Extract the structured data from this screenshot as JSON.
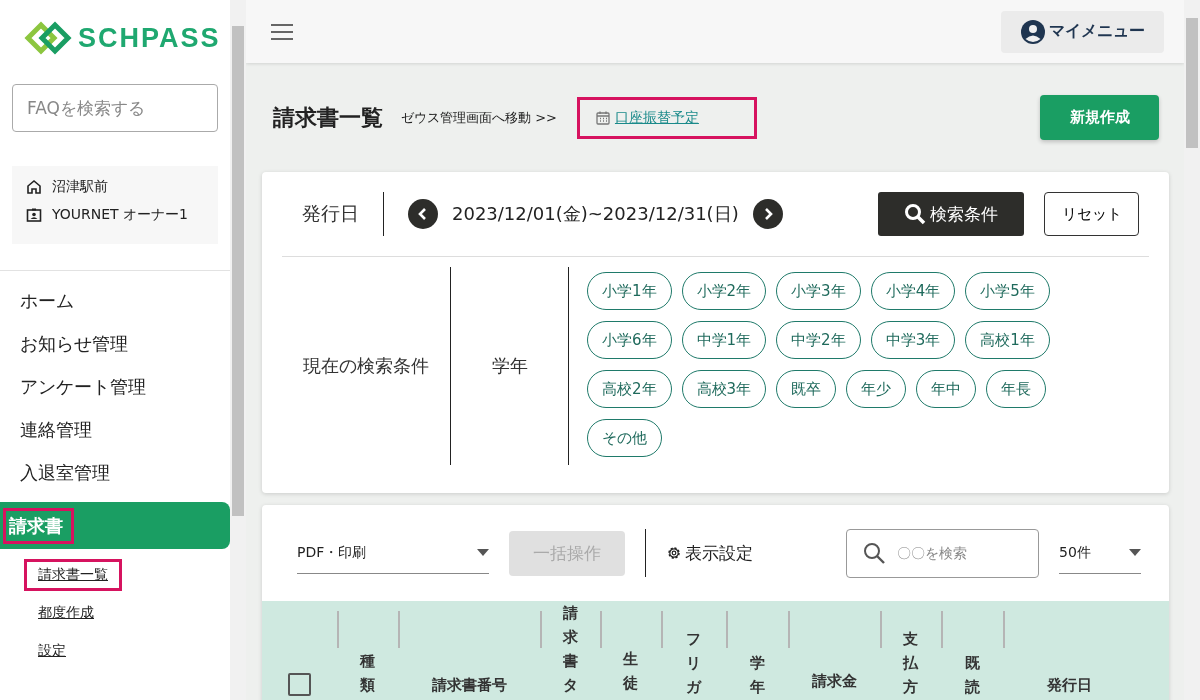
{
  "logo": {
    "text": "SCHPASS"
  },
  "faq_search": {
    "placeholder": "FAQを検索する"
  },
  "account": {
    "school": "沼津駅前",
    "user": "YOURNET オーナー1"
  },
  "nav": [
    {
      "label": "ホーム",
      "selected": false,
      "highlighted": false
    },
    {
      "label": "お知らせ管理",
      "selected": false,
      "highlighted": false
    },
    {
      "label": "アンケート管理",
      "selected": false,
      "highlighted": false
    },
    {
      "label": "連絡管理",
      "selected": false,
      "highlighted": false
    },
    {
      "label": "入退室管理",
      "selected": false,
      "highlighted": false
    },
    {
      "label": "請求書",
      "selected": true,
      "highlighted": true
    }
  ],
  "subnav": [
    {
      "label": "請求書一覧",
      "highlighted": true
    },
    {
      "label": "都度作成",
      "highlighted": false
    },
    {
      "label": "設定",
      "highlighted": false
    }
  ],
  "top_bar": {
    "my_menu": "マイメニュー"
  },
  "page": {
    "title": "請求書一覧",
    "zeus_link": "ゼウス管理画面へ移動 >>",
    "schedule_link": {
      "label": "口座振替予定",
      "highlighted": true
    },
    "new_button": "新規作成"
  },
  "filter": {
    "date_label": "発行日",
    "date_range": "2023/12/01(金)~2023/12/31(日)",
    "search_button": "検索条件",
    "reset_button": "リセット",
    "current_label": "現在の検索条件",
    "grade_label": "学年",
    "grades": [
      "小学1年",
      "小学2年",
      "小学3年",
      "小学4年",
      "小学5年",
      "小学6年",
      "中学1年",
      "中学2年",
      "中学3年",
      "高校1年",
      "高校2年",
      "高校3年",
      "既卒",
      "年少",
      "年中",
      "年長",
      "その他"
    ]
  },
  "toolbar": {
    "print_select": "PDF・印刷",
    "bulk_button": {
      "label": "一括操作",
      "disabled": true
    },
    "display_settings": "表示設定",
    "search": {
      "placeholder": "〇〇を検索"
    },
    "page_size": "50件"
  },
  "table": {
    "select_all_checked": false,
    "columns": [
      "",
      "種類",
      "請求書番号",
      "請求書タ",
      "生徒",
      "フリガ",
      "学年",
      "請求金",
      "支払方",
      "既読",
      "発行日"
    ]
  }
}
